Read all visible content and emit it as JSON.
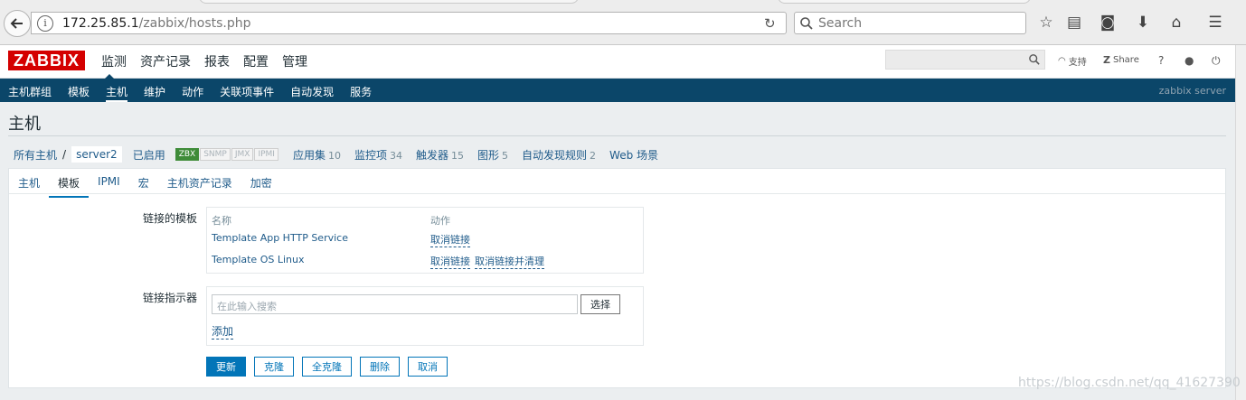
{
  "browser": {
    "url_host": "172.25.85.1",
    "url_path": "/zabbix/hosts.php",
    "search_placeholder": "Search"
  },
  "header": {
    "logo": "ZABBIX",
    "menu": [
      "监测",
      "资产记录",
      "报表",
      "配置",
      "管理"
    ],
    "active_menu": "配置",
    "support": "支持",
    "share": "Share",
    "help": "?"
  },
  "subnav": {
    "items": [
      "主机群组",
      "模板",
      "主机",
      "维护",
      "动作",
      "关联项事件",
      "自动发现",
      "服务"
    ],
    "active": "主机",
    "server": "zabbix server"
  },
  "page_title": "主机",
  "host_nav": {
    "all_hosts": "所有主机",
    "separator": "/",
    "host": "server2",
    "status": "已启用",
    "availability": [
      "ZBX",
      "SNMP",
      "JMX",
      "IPMI"
    ],
    "links": [
      {
        "label": "应用集",
        "count": "10"
      },
      {
        "label": "监控项",
        "count": "34"
      },
      {
        "label": "触发器",
        "count": "15"
      },
      {
        "label": "图形",
        "count": "5"
      },
      {
        "label": "自动发现规则",
        "count": "2"
      },
      {
        "label": "Web 场景",
        "count": ""
      }
    ]
  },
  "tabs": [
    "主机",
    "模板",
    "IPMI",
    "宏",
    "主机资产记录",
    "加密"
  ],
  "active_tab": "模板",
  "linked_templates": {
    "label": "链接的模板",
    "col_name": "名称",
    "col_action": "动作",
    "rows": [
      {
        "name": "Template App HTTP Service",
        "actions": [
          "取消链接"
        ]
      },
      {
        "name": "Template OS Linux",
        "actions": [
          "取消链接",
          "取消链接并清理"
        ]
      }
    ]
  },
  "link_indicator": {
    "label": "链接指示器",
    "placeholder": "在此输入搜索",
    "select_label": "选择",
    "add_label": "添加"
  },
  "buttons": {
    "update": "更新",
    "clone": "克隆",
    "full_clone": "全克隆",
    "delete": "删除",
    "cancel": "取消"
  },
  "watermark": "https://blog.csdn.net/qq_41627390"
}
